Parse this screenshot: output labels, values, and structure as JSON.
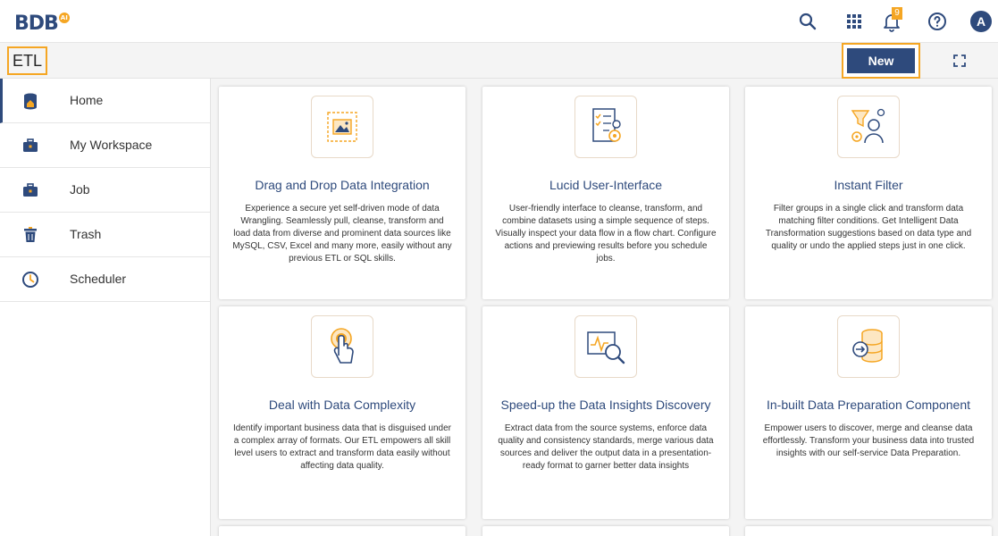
{
  "app": {
    "logo_text": "BDB",
    "logo_badge": "AI",
    "module_title": "ETL"
  },
  "header": {
    "notification_count": "9",
    "avatar_initial": "A"
  },
  "toolbar": {
    "new_label": "New"
  },
  "sidebar": {
    "items": [
      {
        "label": "Home",
        "icon": "home-db-icon",
        "active": true
      },
      {
        "label": "My Workspace",
        "icon": "briefcase-icon"
      },
      {
        "label": "Job",
        "icon": "briefcase-icon"
      },
      {
        "label": "Trash",
        "icon": "trash-icon"
      },
      {
        "label": "Scheduler",
        "icon": "clock-icon"
      }
    ]
  },
  "cards": [
    {
      "title": "Drag and Drop Data Integration",
      "icon": "drag-drop-image-icon",
      "description": "Experience a secure yet self-driven mode of data Wrangling. Seamlessly pull, cleanse, transform and load data from diverse and prominent data sources like MySQL, CSV, Excel and many more, easily without any previous ETL or SQL skills."
    },
    {
      "title": "Lucid User-Interface",
      "icon": "checklist-gears-icon",
      "description": "User-friendly interface to cleanse, transform, and combine datasets using a simple sequence of steps. Visually inspect your data flow in a flow chart. Configure actions and previewing results before you schedule jobs."
    },
    {
      "title": "Instant Filter",
      "icon": "user-filter-gears-icon",
      "description": "Filter groups in a single click and transform data matching filter conditions. Get Intelligent Data Transformation suggestions based on data type and quality or undo the applied steps just in one click."
    },
    {
      "title": "Deal with Data Complexity",
      "icon": "touch-hand-icon",
      "description": "Identify important business data that is disguised under a complex array of formats. Our ETL empowers all skill level users to extract and transform data easily without affecting data quality."
    },
    {
      "title": "Speed-up the Data Insights Discovery",
      "icon": "chart-magnifier-icon",
      "description": "Extract data from the source systems, enforce data quality and consistency standards, merge various data sources and deliver the output data in a presentation-ready format to garner better data insights"
    },
    {
      "title": "In-built Data Preparation Component",
      "icon": "database-import-icon",
      "description": "Empower users to discover, merge and cleanse data effortlessly. Transform your business data into trusted insights with our self-service Data Preparation."
    }
  ],
  "colors": {
    "brand": "#2e4a7c",
    "accent": "#f5a623",
    "background": "#f4f4f4"
  }
}
